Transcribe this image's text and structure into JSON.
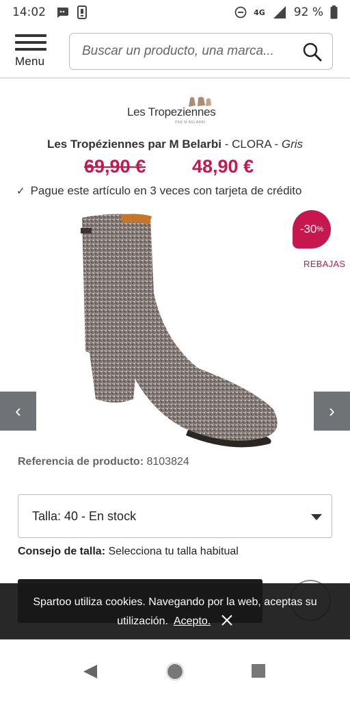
{
  "status": {
    "time": "14:02",
    "network": "4G",
    "battery": "92 %"
  },
  "header": {
    "menu_label": "Menu",
    "search_placeholder": "Buscar un producto, una marca..."
  },
  "product": {
    "brand_logo_text": "Les Tropeziennes",
    "brand_logo_sub": "PAR M.BELARBI",
    "brand": "Les Tropéziennes par M Belarbi",
    "sep1": " - ",
    "model": "CLORA",
    "sep2": " - ",
    "color": "Gris",
    "old_price": "69,90 €",
    "new_price": "48,90 €",
    "installments": "Pague este artículo en 3 veces con tarjeta de crédito",
    "discount": "-30",
    "discount_unit": "%",
    "sale_label": "REBAJAS",
    "reference_label": "Referencia de producto:",
    "reference_value": "8103824",
    "size_selected": "Talla: 40 - En stock",
    "size_advice_label": "Consejo de talla:",
    "size_advice_text": "Selecciona tu talla habitual"
  },
  "cookie": {
    "text_line1": "Spartoo utiliza cookies. Navegando por la web, aceptas su",
    "text_line2": "utilización.",
    "accept": "Acepto."
  },
  "colors": {
    "accent": "#c6174f",
    "arrow_bg": "#6f7377",
    "banner_bg": "#181818"
  }
}
